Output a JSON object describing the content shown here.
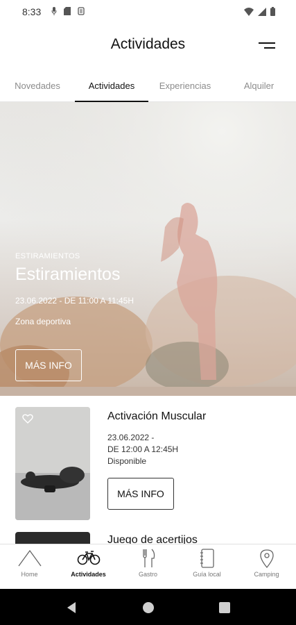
{
  "status_bar": {
    "time": "8:33"
  },
  "header": {
    "title": "Actividades",
    "menu_icon": "menu-icon"
  },
  "tabs": [
    {
      "label": "Novedades",
      "active": false
    },
    {
      "label": "Actividades",
      "active": true
    },
    {
      "label": "Experiencias",
      "active": false
    },
    {
      "label": "Alquiler",
      "active": false
    }
  ],
  "hero": {
    "category": "ESTIRAMIENTOS",
    "title": "Estiramientos",
    "date": "23.06.2022 - DE 11:00 A 11:45H",
    "location": "Zona deportiva",
    "button_label": "MÁS INFO"
  },
  "activities": [
    {
      "title": "Activación Muscular",
      "date_line1": "23.06.2022 -",
      "date_line2": "DE 12:00 A 12:45H",
      "availability": "Disponible",
      "button_label": "MÁS INFO"
    },
    {
      "title": "Juego de acertijos"
    }
  ],
  "bottom_nav": [
    {
      "label": "Home",
      "icon": "tent-icon",
      "active": false
    },
    {
      "label": "Actividades",
      "icon": "bicycle-icon",
      "active": true
    },
    {
      "label": "Gastro",
      "icon": "fork-knife-icon",
      "active": false
    },
    {
      "label": "Guía local",
      "icon": "notebook-icon",
      "active": false
    },
    {
      "label": "Camping",
      "icon": "location-pin-icon",
      "active": false
    }
  ]
}
